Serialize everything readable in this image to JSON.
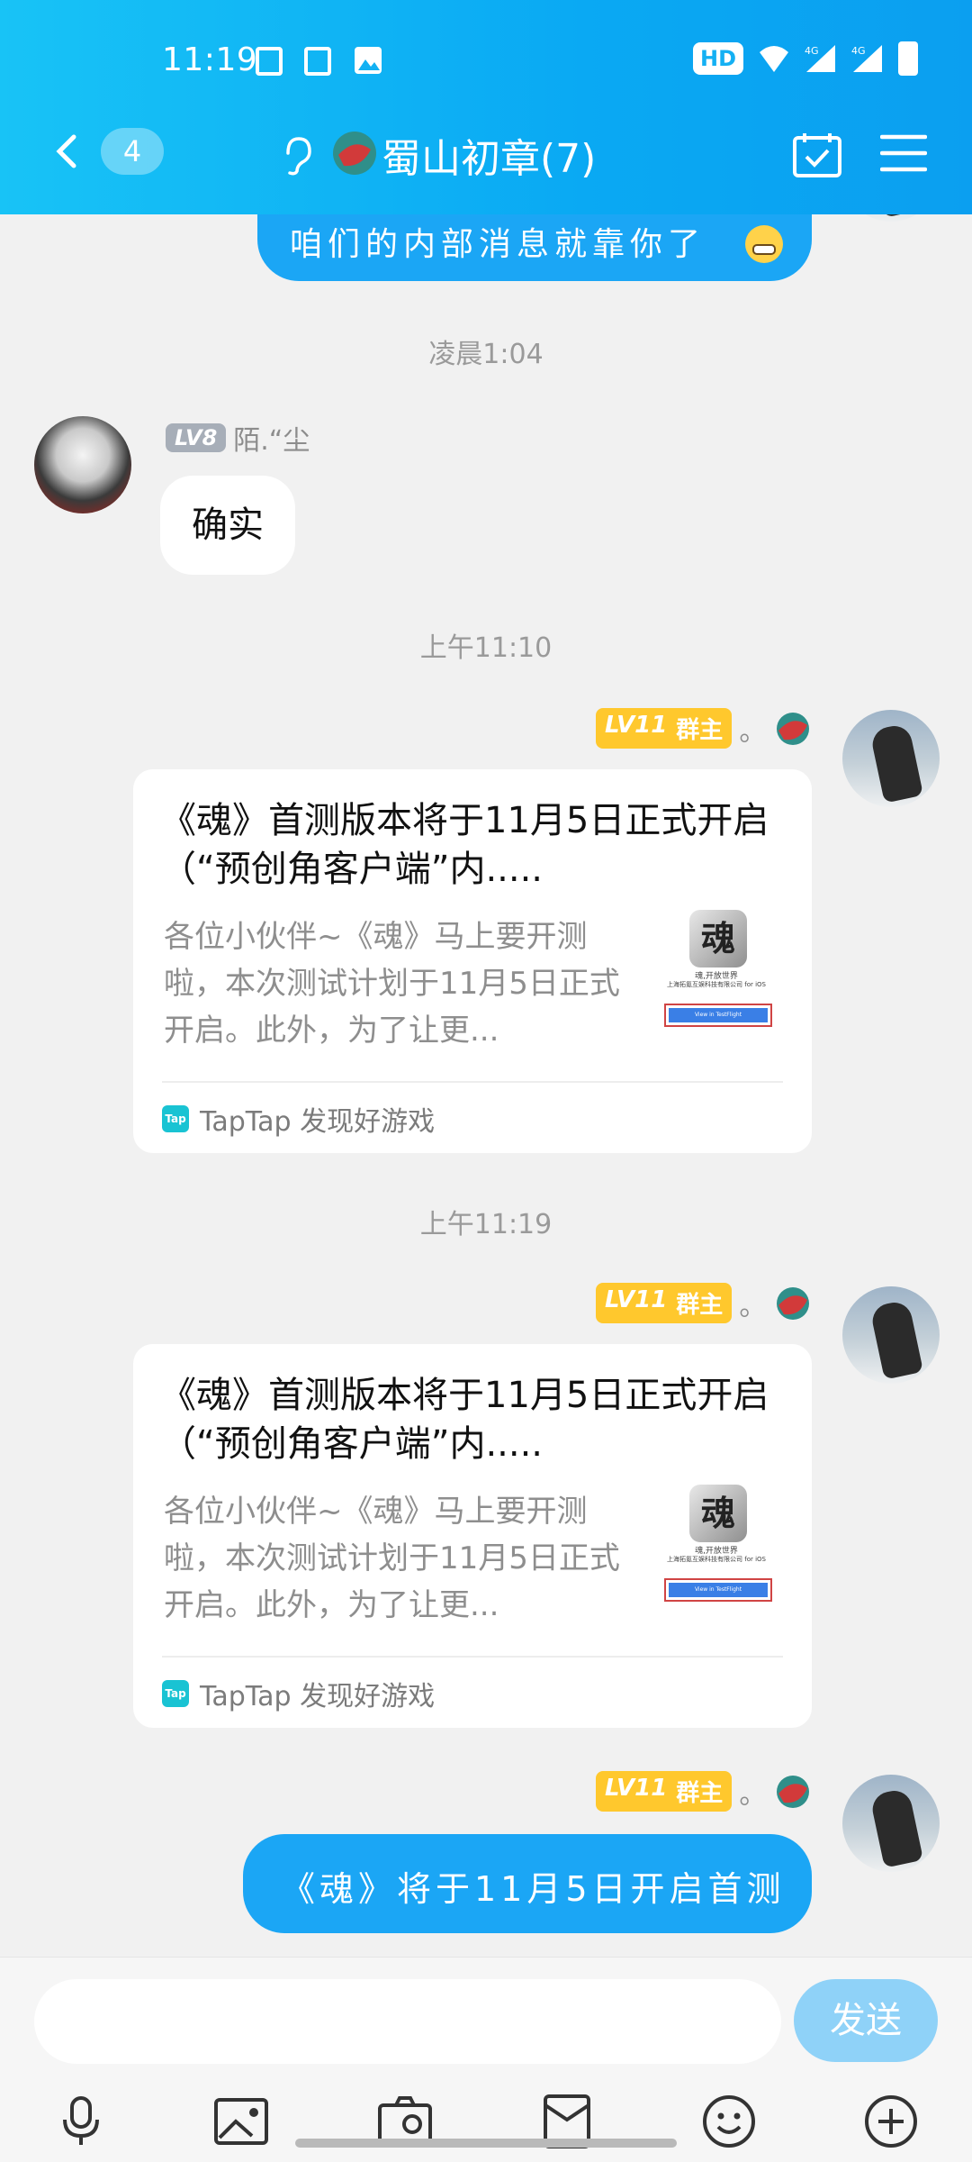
{
  "status_bar": {
    "time": "11:19",
    "hd_label": "HD",
    "net_labels": [
      "4G",
      "4G"
    ]
  },
  "header": {
    "unread_count": "4",
    "title": "蜀山初章(7)"
  },
  "chat": {
    "top_bubble_text": "咱们的内部消息就靠你了",
    "timestamps": [
      "凌晨1:04",
      "上午11:10",
      "上午11:19"
    ],
    "message1": {
      "level": "LV8",
      "sender": "陌.“尘",
      "text": "确实"
    },
    "owner_badge": {
      "level": "LV11",
      "role": "群主"
    },
    "sender_dot": "。",
    "cards": [
      {
        "title": "《魂》首测版本将于11月5日正式开启（“预创角客户端”内.....",
        "desc": "各位小伙伴~《魂》马上要开测啦，本次测试计划于11月5日正式开启。此外，为了让更...",
        "source": "TapTap 发现好游戏",
        "source_icon": "Tap",
        "thumb_title": "魂",
        "thumb_caption": "魂,开放世界",
        "thumb_company": "上海拓氪互娱科技有限公司 for iOS",
        "thumb_button": "View in TestFlight"
      },
      {
        "title": "《魂》首测版本将于11月5日正式开启（“预创角客户端”内.....",
        "desc": "各位小伙伴~《魂》马上要开测啦，本次测试计划于11月5日正式开启。此外，为了让更...",
        "source": "TapTap 发现好游戏",
        "source_icon": "Tap",
        "thumb_title": "魂",
        "thumb_caption": "魂,开放世界",
        "thumb_company": "上海拓氪互娱科技有限公司 for iOS",
        "thumb_button": "View in TestFlight"
      }
    ],
    "last_message": "《魂》将于11月5日开启首测"
  },
  "composer": {
    "placeholder": "",
    "send_label": "发送"
  },
  "toolbar_icons": [
    "microphone-icon",
    "image-icon",
    "camera-icon",
    "red-packet-icon",
    "emoji-icon",
    "plus-icon"
  ],
  "colors": {
    "header": "#0aa9f3",
    "bubble": "#1ba6f5",
    "badge": "#ffc82d",
    "send": "#8fd2f8"
  }
}
